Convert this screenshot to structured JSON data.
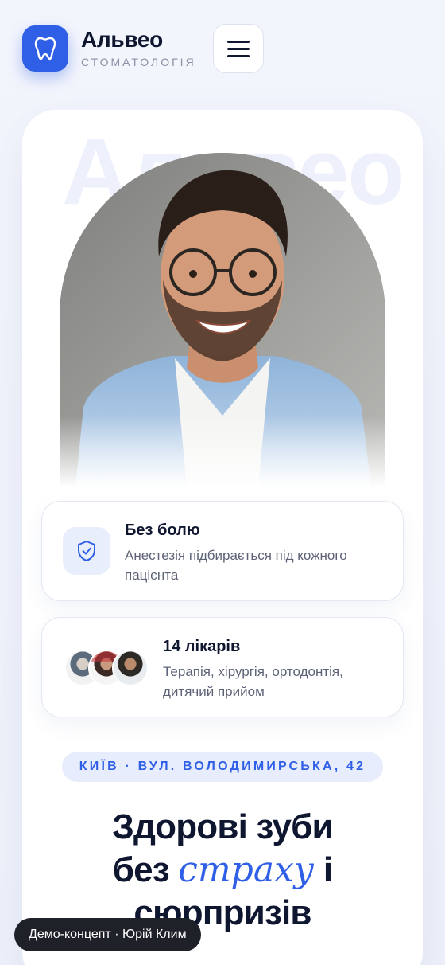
{
  "header": {
    "brand_name": "Альвео",
    "brand_subtitle": "СТОМАТОЛОГІЯ",
    "logo_icon": "tooth-icon",
    "menu_icon": "hamburger-menu-icon"
  },
  "hero": {
    "watermark": "Альвео",
    "photo_alt": "smiling-man-photo"
  },
  "features": [
    {
      "title": "Без болю",
      "text": "Анестезія підбирається під кожного пацієнта",
      "icon": "shield-check-icon"
    },
    {
      "title": "14 лікарів",
      "text": "Терапія, хірургія, ортодонтія, дитячий прийом",
      "icon": "doctor-avatars"
    }
  ],
  "address_pill": "КИЇВ · ВУЛ. ВОЛОДИМИРСЬКА, 42",
  "headline": {
    "line1": "Здорові зуби",
    "line2_before": "без ",
    "line2_accent": "страху",
    "line2_after": " і",
    "line3": "сюрпризів"
  },
  "demo_badge": "Демо-концепт · Юрій Клим",
  "colors": {
    "accent": "#2f5fe6",
    "text": "#0f1630",
    "muted": "#5d6377",
    "background": "#f3f5fc"
  }
}
